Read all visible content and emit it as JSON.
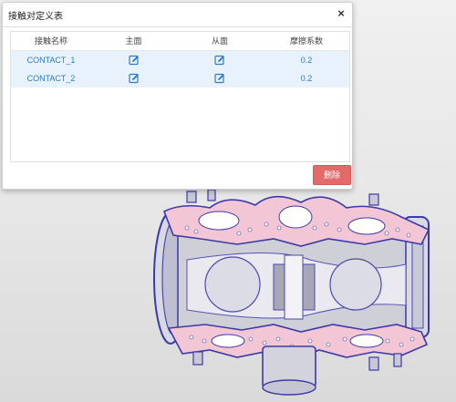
{
  "dialog": {
    "title": "接触对定义表",
    "close_glyph": "×",
    "columns": [
      "接触名称",
      "主面",
      "从面",
      "摩擦系数"
    ],
    "rows": [
      {
        "name": "CONTACT_1",
        "master_icon": "edit-icon",
        "slave_icon": "edit-icon",
        "friction": "0.2"
      },
      {
        "name": "CONTACT_2",
        "master_icon": "edit-icon",
        "slave_icon": "edit-icon",
        "friction": "0.2"
      }
    ],
    "delete_label": "删除"
  },
  "colors": {
    "selected_row_bg": "#e8f2fc",
    "row_text": "#2f7bc4",
    "delete_button": "#e46a6a",
    "mesh_pink": "#f2c6d4",
    "mesh_edge": "#3b3aa8"
  }
}
